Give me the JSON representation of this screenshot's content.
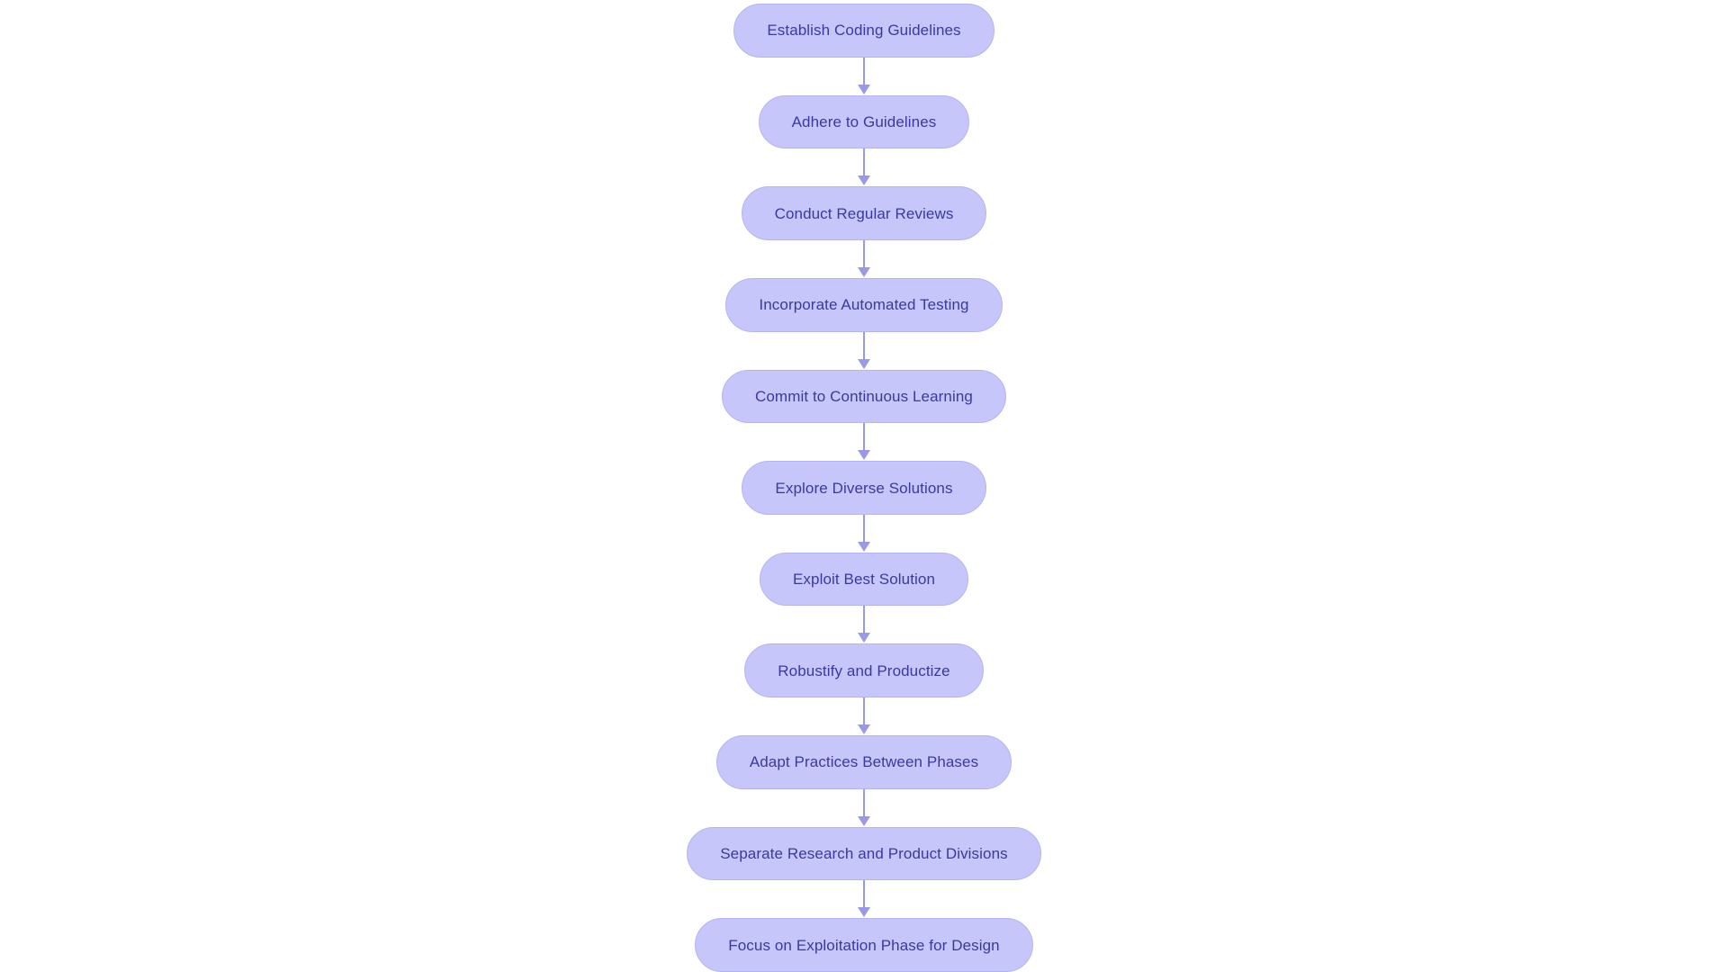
{
  "chart": {
    "type": "flowchart",
    "orientation": "top-to-bottom",
    "background_color": "#ffffff",
    "node_fill_color": "#c6c6fa",
    "node_border_color": "#b4b4f2",
    "node_text_color": "#3a3a9e",
    "connector_color": "#9999e8",
    "node_shape": "stadium",
    "node_count": 12,
    "connector_count": 11,
    "nodes": [
      {
        "id": "n1",
        "label": "Establish Coding Guidelines"
      },
      {
        "id": "n2",
        "label": "Adhere to Guidelines"
      },
      {
        "id": "n3",
        "label": "Conduct Regular Reviews"
      },
      {
        "id": "n4",
        "label": "Incorporate Automated Testing"
      },
      {
        "id": "n5",
        "label": "Commit to Continuous Learning"
      },
      {
        "id": "n6",
        "label": "Explore Diverse Solutions"
      },
      {
        "id": "n7",
        "label": "Exploit Best Solution"
      },
      {
        "id": "n8",
        "label": "Robustify and Productize"
      },
      {
        "id": "n9",
        "label": "Adapt Practices Between Phases"
      },
      {
        "id": "n10",
        "label": "Separate Research and Product Divisions"
      },
      {
        "id": "n11",
        "label": "Focus on Exploitation Phase for Design"
      }
    ],
    "edges": [
      {
        "from": "n1",
        "to": "n2",
        "label": ""
      },
      {
        "from": "n2",
        "to": "n3",
        "label": ""
      },
      {
        "from": "n3",
        "to": "n4",
        "label": ""
      },
      {
        "from": "n4",
        "to": "n5",
        "label": ""
      },
      {
        "from": "n5",
        "to": "n6",
        "label": ""
      },
      {
        "from": "n6",
        "to": "n7",
        "label": ""
      },
      {
        "from": "n7",
        "to": "n8",
        "label": ""
      },
      {
        "from": "n8",
        "to": "n9",
        "label": ""
      },
      {
        "from": "n9",
        "to": "n10",
        "label": ""
      },
      {
        "from": "n10",
        "to": "n11",
        "label": ""
      }
    ]
  }
}
